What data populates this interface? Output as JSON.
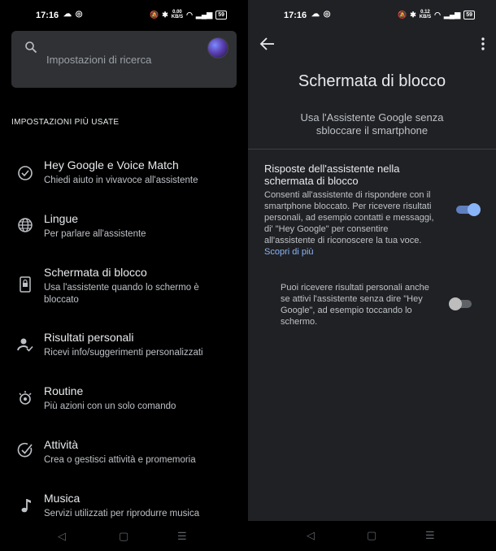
{
  "left": {
    "status": {
      "time": "17:16",
      "speed_top": "0.00",
      "speed_unit": "KB/S",
      "battery": "59"
    },
    "search": {
      "placeholder": "Impostazioni di ricerca"
    },
    "section_title": "IMPOSTAZIONI PIÙ USATE",
    "items": [
      {
        "title": "Hey Google e Voice Match",
        "subtitle": "Chiedi aiuto in vivavoce all'assistente",
        "icon": "voice-match-icon"
      },
      {
        "title": "Lingue",
        "subtitle": "Per parlare all'assistente",
        "icon": "globe-icon"
      },
      {
        "title": "Schermata di blocco",
        "subtitle": "Usa l'assistente quando lo schermo è bloccato",
        "icon": "phone-lock-icon"
      },
      {
        "title": "Risultati personali",
        "subtitle": "Ricevi info/suggerimenti personalizzati",
        "icon": "person-check-icon"
      },
      {
        "title": "Routine",
        "subtitle": "Più azioni con un solo comando",
        "icon": "routine-icon"
      },
      {
        "title": "Attività",
        "subtitle": "Crea o gestisci attività e promemoria",
        "icon": "task-check-icon"
      },
      {
        "title": "Musica",
        "subtitle": "Servizi utilizzati per riprodurre musica",
        "icon": "music-note-icon"
      }
    ]
  },
  "right": {
    "status": {
      "time": "17:16",
      "speed_top": "0.12",
      "speed_unit": "KB/S",
      "battery": "59"
    },
    "title": "Schermata di blocco",
    "subtitle": "Usa l'Assistente Google senza sbloccare il smartphone",
    "setting1": {
      "title": "Risposte dell'assistente nella schermata di blocco",
      "description": "Consenti all'assistente di rispondere con il smartphone bloccato. Per ricevere risultati personali, ad esempio contatti e messaggi, di' \"Hey Google\" per consentire all'assistente di riconoscere la tua voce.",
      "link": "Scopri di più",
      "enabled": true
    },
    "setting2": {
      "description": "Puoi ricevere risultati personali anche se attivi l'assistente senza dire \"Hey Google\", ad esempio toccando lo schermo.",
      "enabled": false
    }
  },
  "colors": {
    "accent": "#8ab4f8",
    "background_left": "#000000",
    "background_right": "#202124",
    "search_box": "#303134"
  },
  "nav": {
    "back": "◁",
    "home": "▢",
    "recents": "☰"
  }
}
